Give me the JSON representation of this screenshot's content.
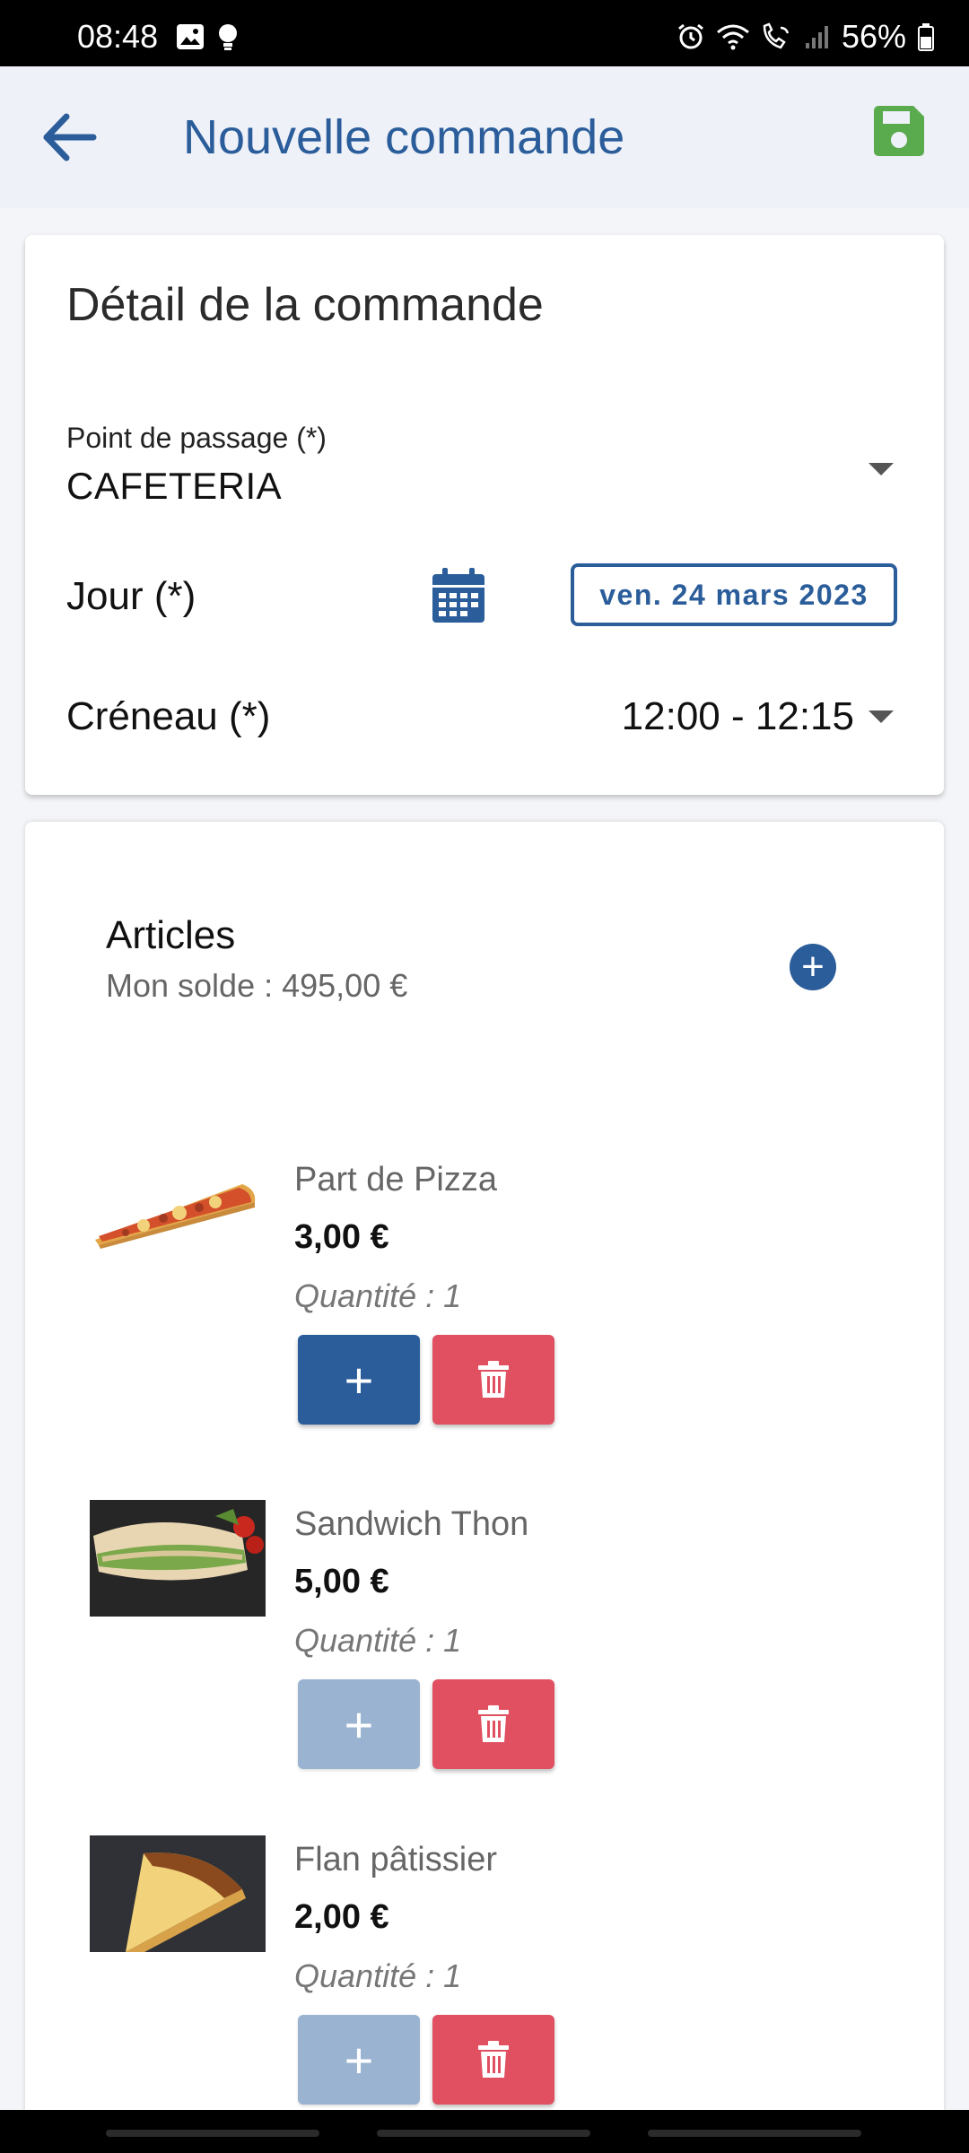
{
  "status_bar": {
    "time": "08:48",
    "battery": "56%",
    "left_icons": [
      "image-icon",
      "bulb-icon"
    ],
    "right_icons": [
      "alarm-icon",
      "wifi-icon",
      "wifi-call-icon",
      "signal-icon",
      "battery-icon"
    ]
  },
  "app_bar": {
    "title": "Nouvelle commande",
    "back_icon": "arrow-left-icon",
    "save_icon": "save-icon",
    "title_color": "#2a5d9a",
    "save_color": "#5aaa4e"
  },
  "details": {
    "title": "Détail de la commande",
    "point_label": "Point de passage (*)",
    "point_value": "CAFETERIA",
    "jour_label": "Jour (*)",
    "calendar_icon": "calendar-icon",
    "date_value": "ven. 24 mars 2023",
    "creneau_label": "Créneau (*)",
    "creneau_value": "12:00 - 12:15"
  },
  "articles": {
    "title": "Articles",
    "solde": "Mon solde : 495,00 €",
    "add_label": "+",
    "items": [
      {
        "name": "Part de Pizza",
        "price": "3,00 €",
        "quantity": "Quantité : 1",
        "image": "pizza-slice",
        "plus_label": "+",
        "plus_enabled": true
      },
      {
        "name": "Sandwich Thon",
        "price": "5,00 €",
        "quantity": "Quantité : 1",
        "image": "tuna-sandwich",
        "plus_label": "+",
        "plus_enabled": false
      },
      {
        "name": "Flan pâtissier",
        "price": "2,00 €",
        "quantity": "Quantité : 1",
        "image": "flan-slice",
        "plus_label": "+",
        "plus_enabled": false
      }
    ]
  },
  "colors": {
    "primary": "#2a5d9a",
    "primary_disabled": "#9ab3d1",
    "danger": "#e05061",
    "save_green": "#5aaa4e"
  }
}
